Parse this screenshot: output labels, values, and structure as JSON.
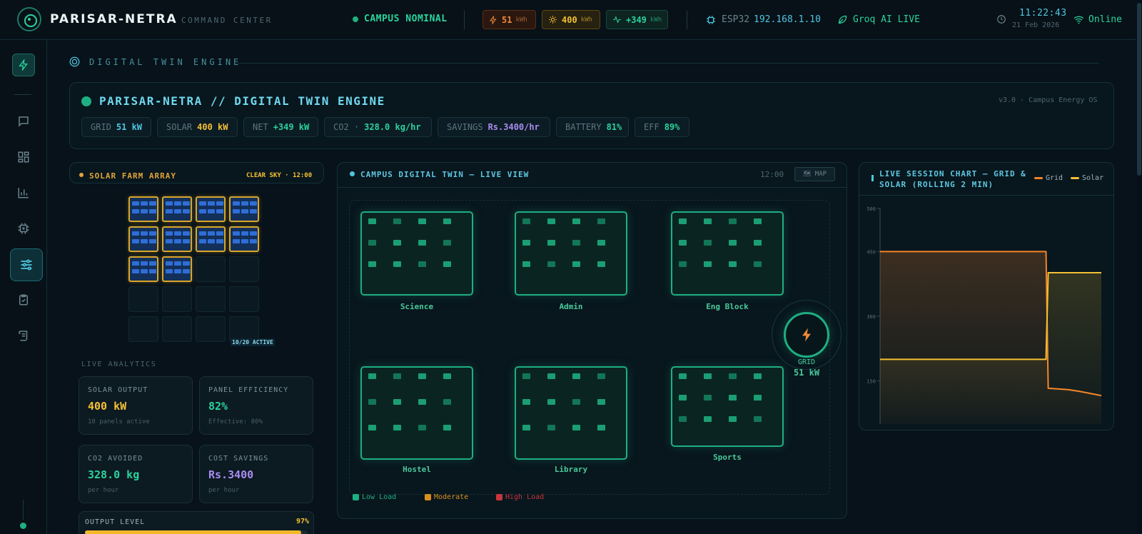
{
  "header": {
    "brand": "PARISAR-NETRA",
    "subtitle": "COMMAND CENTER",
    "campus_status": "CAMPUS NOMINAL",
    "grid_value": "51",
    "solar_value": "400",
    "net_value": "+349",
    "unit": "kWh",
    "esp_label": "ESP32",
    "esp_ip": "192.168.1.10",
    "ai_status": "Groq AI LIVE",
    "time": "11:22:43",
    "date": "21 Feb 2026",
    "connection": "Online"
  },
  "sidebar": {
    "items": [
      {
        "icon": "bolt-icon"
      },
      {
        "icon": "chat-icon"
      },
      {
        "icon": "dashboard-grid-icon"
      },
      {
        "icon": "bar-chart-icon"
      },
      {
        "icon": "chip-icon"
      },
      {
        "icon": "sliders-icon",
        "active": true
      },
      {
        "icon": "clipboard-check-icon"
      },
      {
        "icon": "scroll-icon"
      }
    ]
  },
  "page": {
    "section_title": "DIGITAL TWIN ENGINE",
    "engine_title": "PARISAR-NETRA // DIGITAL TWIN ENGINE",
    "version": "v3.0 · Campus Energy OS",
    "metrics": [
      {
        "label": "GRID",
        "value": "51 kW",
        "color": "#4fc6e0"
      },
      {
        "label": "SOLAR",
        "value": "400 kW",
        "color": "#f5c033"
      },
      {
        "label": "NET",
        "value": "+349 kW",
        "color": "#2bd39d"
      },
      {
        "label": "CO2 ·",
        "value": "328.0 kg/hr",
        "color": "#2bd39d"
      },
      {
        "label": "SAVINGS",
        "value": "Rs.3400/hr",
        "color": "#a98cf0"
      },
      {
        "label": "BATTERY",
        "value": "81%",
        "color": "#2bd39d"
      },
      {
        "label": "EFF",
        "value": "89%",
        "color": "#2bd39d"
      }
    ]
  },
  "solar": {
    "title": "SOLAR FARM ARRAY",
    "sky": "CLEAR SKY · 12:00",
    "panels_active": 10,
    "panels_total": 20,
    "active_label": "10/20 ACTIVE",
    "analytics_label": "LIVE ANALYTICS",
    "cards": [
      {
        "label": "SOLAR OUTPUT",
        "value": "400 kW",
        "sub": "10 panels active",
        "color": "#f5c033"
      },
      {
        "label": "PANEL EFFICIENCY",
        "value": "82%",
        "sub": "Effective: 80%",
        "color": "#2bd39d"
      },
      {
        "label": "CO2 AVOIDED",
        "value": "328.0 kg",
        "sub": "per hour",
        "color": "#2bd39d"
      },
      {
        "label": "COST SAVINGS",
        "value": "Rs.3400",
        "sub": "per hour",
        "color": "#a98cf0"
      }
    ],
    "output_label": "OUTPUT LEVEL",
    "output_value": "97%",
    "output_fraction": 0.97
  },
  "campus": {
    "title": "CAMPUS DIGITAL TWIN — LIVE VIEW",
    "time": "12:00",
    "map_button": "🗺 MAP",
    "buildings": [
      "Science",
      "Admin",
      "Eng Block",
      "Hostel",
      "Library",
      "Sports"
    ],
    "grid_label": "GRID",
    "grid_value": "51 kW",
    "legend": [
      {
        "label": "Low Load",
        "color": "#1fae82"
      },
      {
        "label": "Moderate",
        "color": "#d9901e"
      },
      {
        "label": "High Load",
        "color": "#c8343c"
      }
    ]
  },
  "chart_data": {
    "type": "line",
    "title": "LIVE SESSION CHART — GRID & SOLAR (ROLLING 2 MIN)",
    "xlabel": "",
    "ylabel": "",
    "ylim": [
      0,
      500
    ],
    "yticks": [
      "500",
      "450",
      "300",
      "150"
    ],
    "grid": false,
    "legend_position": "top-right",
    "x": [
      0,
      1,
      2,
      3,
      4,
      5,
      6,
      7,
      8,
      9,
      10,
      11,
      12,
      13,
      14,
      15,
      16,
      17,
      18,
      19,
      20
    ],
    "series": [
      {
        "name": "Grid",
        "color": "#f5842a",
        "values": [
          400,
          400,
          400,
          400,
          400,
          400,
          400,
          400,
          400,
          400,
          400,
          400,
          400,
          400,
          400,
          400,
          83,
          80,
          76,
          71,
          66
        ]
      },
      {
        "name": "Solar",
        "color": "#f5c033",
        "values": [
          150,
          150,
          150,
          150,
          150,
          150,
          150,
          150,
          150,
          150,
          150,
          150,
          150,
          150,
          150,
          150,
          351,
          351,
          351,
          351,
          351
        ]
      }
    ]
  }
}
